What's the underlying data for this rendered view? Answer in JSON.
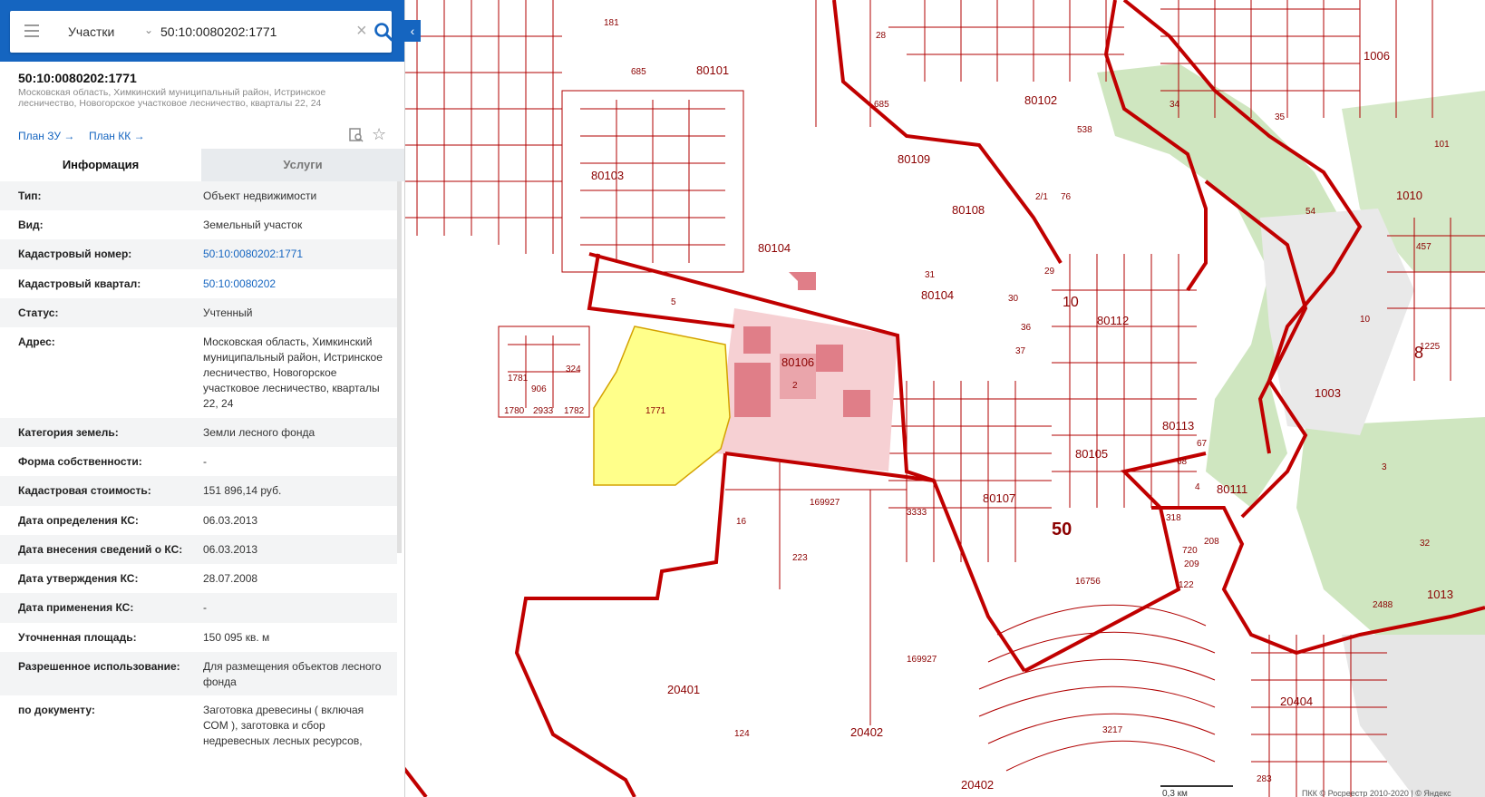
{
  "search": {
    "layer": "Участки",
    "query": "50:10:0080202:1771"
  },
  "card": {
    "title": "50:10:0080202:1771",
    "address": "Московская область, Химкинский муниципальный район, Истринское лесничество, Новогорское участковое лесничество, кварталы 22, 24",
    "plan_zu": "План ЗУ →",
    "plan_kk": "План КК →"
  },
  "tabs": {
    "info": "Информация",
    "services": "Услуги"
  },
  "rows": [
    {
      "label": "Тип:",
      "value": "Объект недвижимости"
    },
    {
      "label": "Вид:",
      "value": "Земельный участок"
    },
    {
      "label": "Кадастровый номер:",
      "value": "50:10:0080202:1771"
    },
    {
      "label": "Кадастровый квартал:",
      "value": "50:10:0080202"
    },
    {
      "label": "Статус:",
      "value": "Учтенный"
    },
    {
      "label": "Адрес:",
      "value": "Московская область, Химкинский муниципальный район, Истринское лесничество, Новогорское участковое лесничество, кварталы 22, 24"
    },
    {
      "label": "Категория земель:",
      "value": "Земли лесного фонда"
    },
    {
      "label": "Форма собственности:",
      "value": "-"
    },
    {
      "label": "Кадастровая стоимость:",
      "value": "151 896,14 руб."
    },
    {
      "label": "Дата определения КС:",
      "value": "06.03.2013"
    },
    {
      "label": "Дата внесения сведений о КС:",
      "value": "06.03.2013"
    },
    {
      "label": "Дата утверждения КС:",
      "value": "28.07.2008"
    },
    {
      "label": "Дата применения КС:",
      "value": "-"
    },
    {
      "label": "Уточненная площадь:",
      "value": "150 095 кв. м"
    },
    {
      "label": "Разрешенное использование:",
      "value": "Для размещения объектов лесного фонда"
    },
    {
      "label": "по документу:",
      "value": "Заготовка древесины ( включая СОМ ), заготовка и сбор недревесных лесных ресурсов,"
    }
  ],
  "map": {
    "labels": [
      "80101",
      "80102",
      "80103",
      "80104",
      "80104",
      "80106",
      "80107",
      "80108",
      "80109",
      "80105",
      "80112",
      "80113",
      "80111",
      "1771",
      "5",
      "16",
      "223",
      "169927",
      "169927",
      "20401",
      "20402",
      "20402",
      "124",
      "16756",
      "3333",
      "20404",
      "1003",
      "1010",
      "1013",
      "1006",
      "50",
      "8",
      "10",
      "10",
      "2/1",
      "76",
      "685",
      "685",
      "181",
      "28",
      "538",
      "34",
      "35",
      "2488",
      "3217",
      "457",
      "2933",
      "1782",
      "1780",
      "318",
      "720",
      "208",
      "209",
      "122",
      "283",
      "29",
      "30",
      "31",
      "37",
      "36",
      "67",
      "68",
      "4",
      "2",
      "3",
      "101",
      "32",
      "54",
      "1225",
      "1781",
      "324",
      "906"
    ],
    "scale_text": "0,3 км",
    "copyright": "ПКК © Росреестр 2010-2020 | © Яндекс"
  }
}
